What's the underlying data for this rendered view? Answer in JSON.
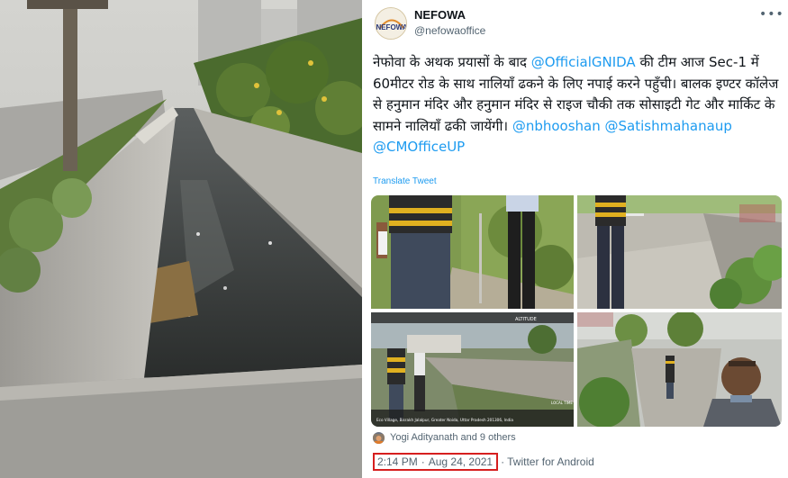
{
  "tweet": {
    "author_name": "NEFOWA",
    "author_handle": "@nefowaoffice",
    "avatar_label": "NEFOWA",
    "text_segments": [
      {
        "type": "text",
        "value": "नेफोवा के अथक प्रयासों के बाद "
      },
      {
        "type": "mention",
        "value": "@OfficialGNIDA"
      },
      {
        "type": "text",
        "value": " की टीम आज Sec-1 में 60मीटर रोड के साथ नालियाँ ढकने के लिए नपाई करने पहुँची। बालक इण्टर कॉलेज से हनुमान मंदिर और हनुमान मंदिर से राइज चौकी तक सोसाइटी गेट और मार्किट के सामने नालियाँ ढकी जायेंगी। "
      },
      {
        "type": "mention",
        "value": "@nbhooshan"
      },
      {
        "type": "text",
        "value": " "
      },
      {
        "type": "mention",
        "value": "@Satishmahanaup"
      },
      {
        "type": "text",
        "value": " "
      },
      {
        "type": "mention",
        "value": "@CMOfficeUP"
      }
    ],
    "translate_label": "Translate Tweet",
    "liked_by": "Yogi Adityanath and 9 others",
    "time": "2:14 PM",
    "dot": "·",
    "date": "Aug 24, 2021",
    "source": "Twitter for Android"
  },
  "media": {
    "photo3_caption": "Eco Village, Bisrakh Jalalpur, Greater Noida, Uttar Pradesh 201306, India",
    "photo3_altitude": "ALTITUDE",
    "photo3_local_time": "LOCAL TIME"
  },
  "colors": {
    "accent": "#1d9bf0",
    "highlight_border": "#d61f1f",
    "secondary_text": "#536471"
  }
}
